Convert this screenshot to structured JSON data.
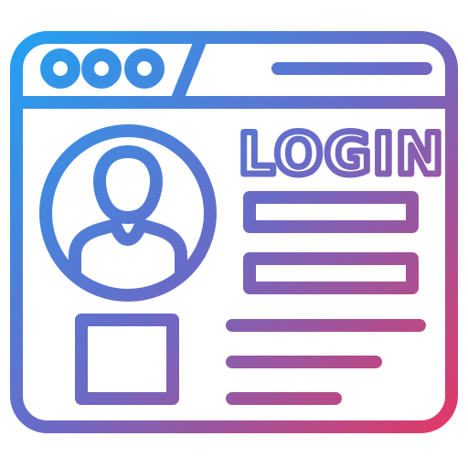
{
  "icon": {
    "name": "login-window-icon",
    "gradient": {
      "start": "#1aa7f7",
      "mid": "#6a6ac7",
      "end": "#f2335a"
    },
    "window_dots": [
      "dot-1",
      "dot-2",
      "dot-3"
    ],
    "login_label": "LOGIN",
    "fields": [
      "username-field",
      "password-field"
    ],
    "text_lines": [
      "text-line-1",
      "text-line-2",
      "text-line-3"
    ]
  }
}
